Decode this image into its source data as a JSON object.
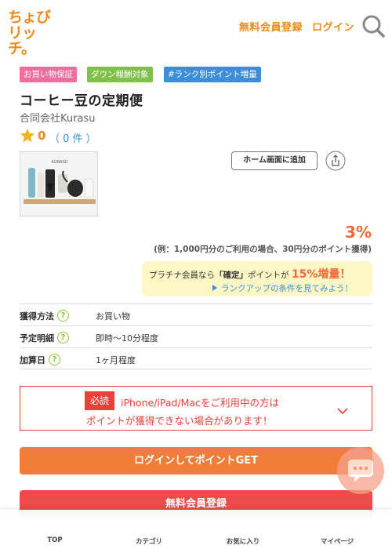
{
  "header": {
    "logo_line1": "ちょび",
    "logo_line2": "リッチ。",
    "register_label": "無料会員登録",
    "login_label": "ログイン",
    "search_icon": "search-icon"
  },
  "badges": [
    "お買い物保証",
    "ダウン報酬対象",
    "#ランク別ポイント増量"
  ],
  "product": {
    "title": "コーヒー豆の定期便",
    "company": "合同会社Kurasu",
    "rating_score": "0",
    "rating_count": "（ 0 件 ）",
    "image_alt": "KURASU",
    "home_add_label": "ホーム画面に追加",
    "share_icon": "share-icon"
  },
  "reward": {
    "rate": "3%",
    "note": "(例：1,000円分のご利用の場合、30円分のポイント獲得)"
  },
  "platinum": {
    "prefix": "プラチナ会員なら",
    "kakutei": "「確定」",
    "middle": "ポイントが",
    "boost": "15%増量！",
    "link": "ランクアップの条件を見てみよう！"
  },
  "info": [
    {
      "label": "獲得方法",
      "value": "お買い物"
    },
    {
      "label": "予定明細",
      "value": "即時〜10分程度"
    },
    {
      "label": "加算日",
      "value": "1ヶ月程度"
    }
  ],
  "notice": {
    "tag": "必読",
    "line1": "iPhone/iPad/Macをご利用中の方は",
    "line2": "ポイントが獲得できない場合があります！"
  },
  "buttons": {
    "login_get": "ログインしてポイントGET",
    "register": "無料会員登録"
  },
  "tabbar": [
    "TOP",
    "カテゴリ",
    "お気に入り",
    "マイページ"
  ],
  "colors": {
    "brand": "#f08a1c",
    "alert": "#e8403a",
    "link": "#3b8fd8"
  }
}
